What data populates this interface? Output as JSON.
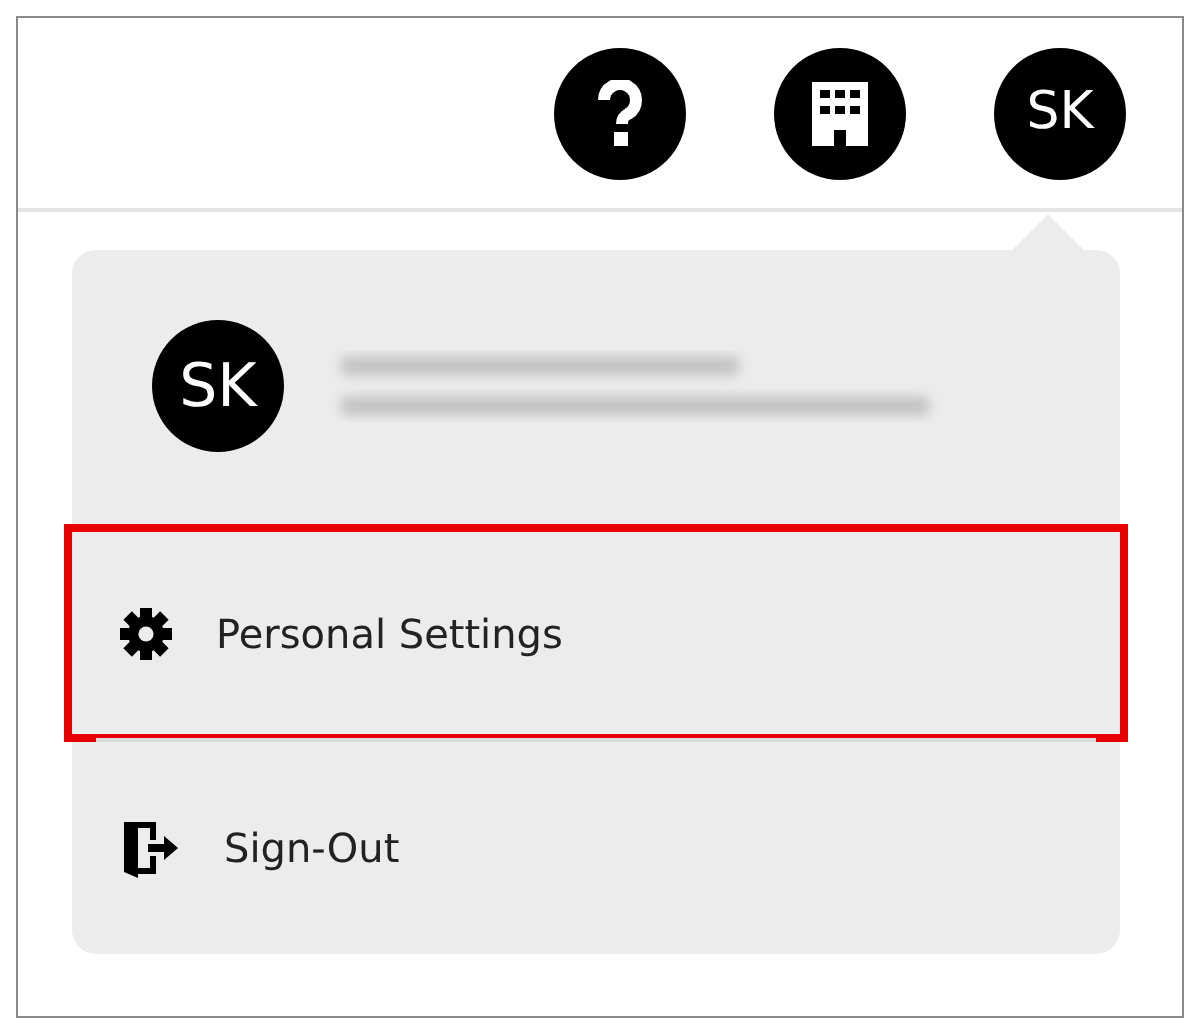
{
  "top_bar": {
    "buttons": [
      {
        "kind": "help"
      },
      {
        "kind": "building"
      },
      {
        "kind": "avatar",
        "initials": "SK"
      }
    ]
  },
  "account_menu": {
    "user": {
      "initials": "SK"
    },
    "items": [
      {
        "kind": "settings",
        "label": "Personal Settings",
        "highlighted": true
      },
      {
        "kind": "sign_out",
        "label": "Sign-Out",
        "highlighted": false
      }
    ]
  }
}
